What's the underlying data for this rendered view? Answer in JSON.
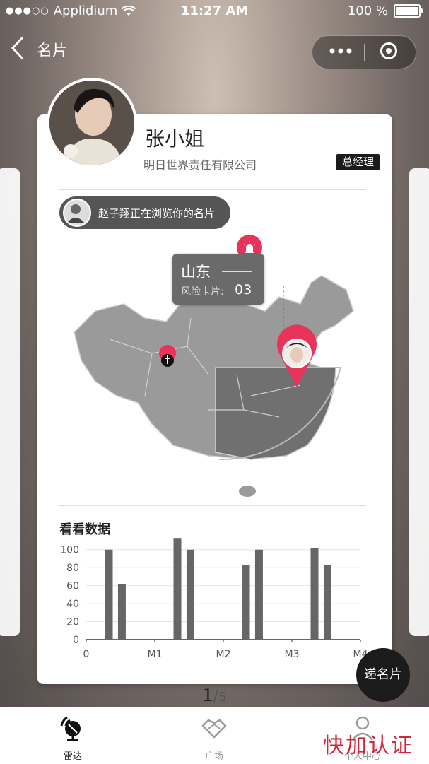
{
  "status_bar": {
    "signal_dots": "●●●○○",
    "carrier": "Applidium",
    "time": "11:27 AM",
    "battery": "100 %"
  },
  "nav": {
    "back_icon": "chevron-left-icon",
    "title": "名片",
    "more_icon": "more-icon",
    "record_icon": "record-icon"
  },
  "card": {
    "name": "张小姐",
    "company": "明日世界责任有限公司",
    "job_title": "总经理",
    "browsing_text": "赵子翔正在浏览你的名片",
    "map": {
      "province": "山东",
      "risk_label": "风险卡片:",
      "risk_value": "03"
    },
    "chart_title": "看看数据"
  },
  "chart_data": {
    "type": "bar",
    "xlabel": "",
    "ylabel": "",
    "x_ticks": [
      "0",
      "M1",
      "M2",
      "M3",
      "M4"
    ],
    "x_range": [
      0,
      4
    ],
    "y_ticks": [
      "0",
      "20",
      "40",
      "60",
      "80",
      "100"
    ],
    "ylim": [
      0,
      110
    ],
    "grid": true,
    "bars": [
      {
        "x": 0.33,
        "value": 100
      },
      {
        "x": 0.52,
        "value": 62
      },
      {
        "x": 1.33,
        "value": 113
      },
      {
        "x": 1.52,
        "value": 100
      },
      {
        "x": 2.33,
        "value": 83
      },
      {
        "x": 2.52,
        "value": 100
      },
      {
        "x": 3.33,
        "value": 102
      },
      {
        "x": 3.52,
        "value": 83
      }
    ],
    "bar_color": "#666666"
  },
  "send_button": "递名片",
  "pager": {
    "current": "1",
    "separator": "/",
    "total": "5"
  },
  "tabbar": [
    {
      "label": "雷达",
      "icon": "radar-icon",
      "active": true
    },
    {
      "label": "广场",
      "icon": "handshake-icon",
      "active": false
    },
    {
      "label": "个人中心",
      "icon": "person-icon",
      "active": false
    }
  ],
  "watermark": "快加认证",
  "colors": {
    "accent": "#e8345a",
    "dark": "#1b1b1b",
    "map_gray": "#8c8c8c"
  }
}
